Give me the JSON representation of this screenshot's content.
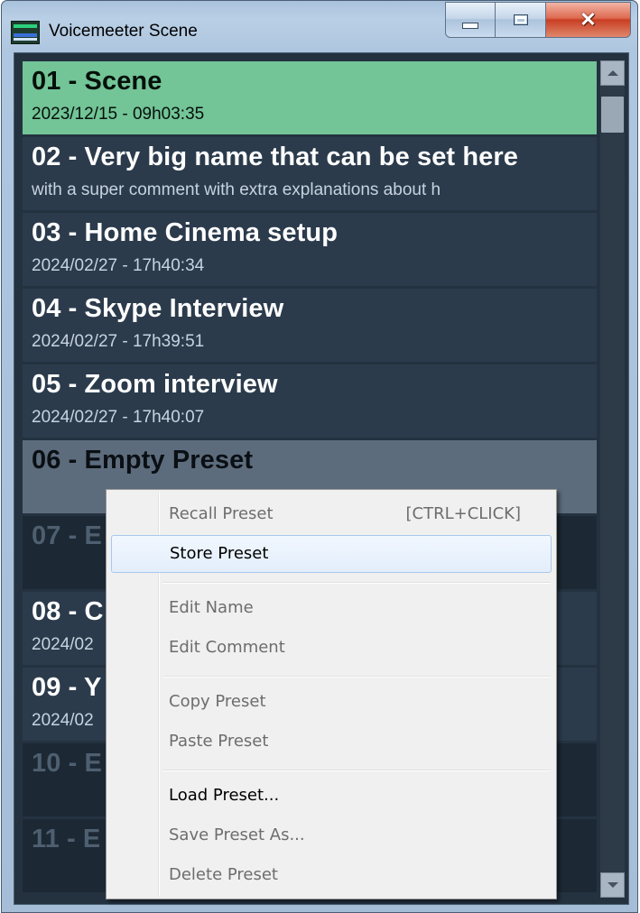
{
  "window": {
    "title": "Voicemeeter Scene",
    "icon": "voicemeeter-app-icon",
    "caption_buttons": {
      "minimize": "minimize-icon",
      "maximize": "maximize-icon",
      "close": "close-icon"
    }
  },
  "presets": [
    {
      "name": "01 - Scene",
      "sub": "2023/12/15 - 09h03:35",
      "state": "selected"
    },
    {
      "name": "02 - Very big name that can be set here",
      "sub": "with a super comment with extra explanations about h",
      "state": "filled"
    },
    {
      "name": "03 - Home Cinema setup",
      "sub": "2024/02/27 - 17h40:34",
      "state": "filled"
    },
    {
      "name": "04 - Skype Interview",
      "sub": "2024/02/27 - 17h39:51",
      "state": "filled"
    },
    {
      "name": "05 - Zoom interview",
      "sub": "2024/02/27 - 17h40:07",
      "state": "filled"
    },
    {
      "name": "06 - Empty Preset",
      "sub": "",
      "state": "hover"
    },
    {
      "name": "07 - E",
      "sub": "",
      "state": "empty"
    },
    {
      "name": "08 - C",
      "sub": "2024/02",
      "state": "filled"
    },
    {
      "name": "09 - Y",
      "sub": "2024/02",
      "state": "filled"
    },
    {
      "name": "10 - E",
      "sub": "",
      "state": "empty"
    },
    {
      "name": "11 - E",
      "sub": "",
      "state": "empty"
    }
  ],
  "scrollbar": {
    "up": "scroll-up-arrow-icon",
    "down": "scroll-down-arrow-icon"
  },
  "context_menu": {
    "items": [
      {
        "label": "Recall Preset",
        "shortcut": "[CTRL+CLICK]",
        "enabled": false
      },
      {
        "label": "Store Preset",
        "shortcut": "",
        "enabled": true,
        "highlighted": true
      },
      {
        "label": "Edit Name",
        "shortcut": "",
        "enabled": false
      },
      {
        "label": "Edit Comment",
        "shortcut": "",
        "enabled": false
      },
      {
        "label": "Copy Preset",
        "shortcut": "",
        "enabled": false
      },
      {
        "label": "Paste Preset",
        "shortcut": "",
        "enabled": false
      },
      {
        "label": "Load Preset...",
        "shortcut": "",
        "enabled": true
      },
      {
        "label": "Save Preset As...",
        "shortcut": "",
        "enabled": false
      },
      {
        "label": "Delete Preset",
        "shortcut": "",
        "enabled": false
      }
    ]
  },
  "colors": {
    "selected_bg": "#73c497",
    "filled_bg": "#2b3b4c",
    "hover_bg": "#5d6c7c",
    "empty_bg": "#1c2834",
    "client_bg": "#243240"
  }
}
